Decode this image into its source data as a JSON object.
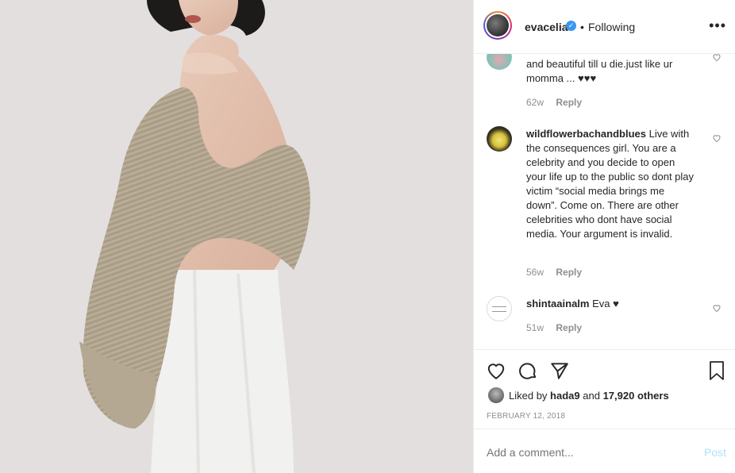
{
  "header": {
    "username": "evacelia",
    "verified_icon": "verified-badge-icon",
    "separator": "•",
    "follow_status": "Following",
    "more_label": "•••"
  },
  "comments": [
    {
      "username": "",
      "text": "and beautiful till u die.just like ur momma ... ♥♥♥",
      "age": "62w",
      "reply": "Reply"
    },
    {
      "username": "wildflowerbachandblues",
      "text": "Live with the consequences girl. You are a celebrity and you decide to open your life up to the public so dont play victim “social media brings me down”. Come on. There are other celebrities who dont have social media. Your argument is invalid.",
      "age": "56w",
      "reply": "Reply"
    },
    {
      "username": "shintaainalm",
      "text": "Eva ♥",
      "age": "51w",
      "reply": "Reply"
    }
  ],
  "likes": {
    "prefix": "Liked by",
    "user": "hada9",
    "middle": "and",
    "count": "17,920 others"
  },
  "date": "FEBRUARY 12, 2018",
  "add_comment": {
    "placeholder": "Add a comment...",
    "post_label": "Post"
  },
  "colors": {
    "accent": "#3897f0",
    "muted": "#8e8e8e",
    "post_disabled": "#b2dffc"
  }
}
